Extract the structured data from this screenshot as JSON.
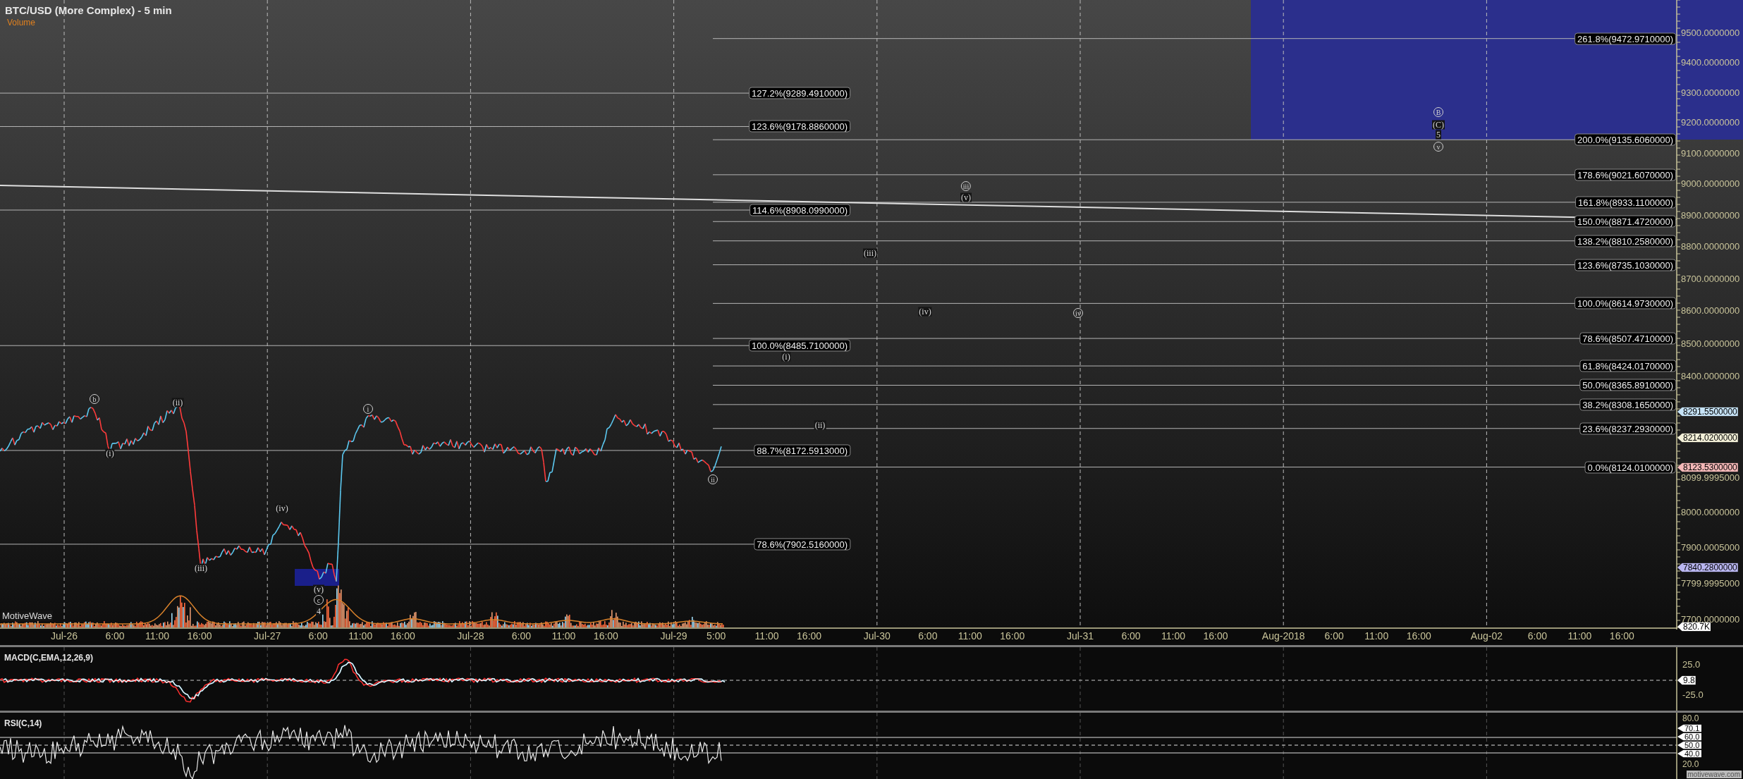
{
  "chart": {
    "title": "BTC/USD (More Complex) - 5 min",
    "overlay_label": "Volume",
    "brand_label": "MotiveWave"
  },
  "fib_levels_left": [
    "127.2%(9289.4910000)",
    "123.6%(9178.8860000)",
    "114.6%(8908.0990000)",
    "100.0%(8485.7100000)",
    "88.7%(8172.5913000)",
    "78.6%(7902.5160000)"
  ],
  "fib_levels_right": [
    "261.8%(9472.9710000)",
    "200.0%(9135.6060000)",
    "178.6%(9021.6070000)",
    "161.8%(8933.1100000)",
    "150.0%(8871.4720000)",
    "138.2%(8810.2580000)",
    "123.6%(8735.1030000)",
    "100.0%(8614.9730000)",
    "78.6%(8507.4710000)",
    "61.8%(8424.0170000)",
    "50.0%(8365.8910000)",
    "38.2%(8308.1650000)",
    "23.6%(8237.2930000)",
    "0.0%(8124.0100000)"
  ],
  "wave_labels": [
    {
      "text": "b",
      "kind": "circled"
    },
    {
      "text": "(ii)",
      "kind": "plain"
    },
    {
      "text": "(i)",
      "kind": "plain"
    },
    {
      "text": "(iii)",
      "kind": "plain"
    },
    {
      "text": "(iv)",
      "kind": "plain"
    },
    {
      "text": "(v)",
      "kind": "plain"
    },
    {
      "text": "c",
      "kind": "circled"
    },
    {
      "text": "4",
      "kind": "plain"
    },
    {
      "text": "i",
      "kind": "circled"
    },
    {
      "text": "ii",
      "kind": "circled"
    },
    {
      "text": "(i)",
      "kind": "plain"
    },
    {
      "text": "(ii)",
      "kind": "plain"
    },
    {
      "text": "(iii)",
      "kind": "plain"
    },
    {
      "text": "(iv)",
      "kind": "plain"
    },
    {
      "text": "iii",
      "kind": "circled"
    },
    {
      "text": "(v)",
      "kind": "plain"
    },
    {
      "text": "iv",
      "kind": "circled"
    },
    {
      "text": "B",
      "kind": "circled"
    },
    {
      "text": "(C)",
      "kind": "plain"
    },
    {
      "text": "5",
      "kind": "plain"
    },
    {
      "text": "v",
      "kind": "circled"
    }
  ],
  "price_axis": {
    "ticks": [
      "9500.0000000",
      "9400.0000000",
      "9300.0000000",
      "9200.0000000",
      "9100.0000000",
      "9000.0000000",
      "8900.0000000",
      "8800.0000000",
      "8700.0000000",
      "8600.0000000",
      "8500.0000000",
      "8400.0000000",
      "8099.9995000",
      "8000.0000000",
      "7900.0005000",
      "7799.9995000",
      "7700.0000000"
    ],
    "tags": [
      {
        "text": "8291.5500000",
        "color": "#c6e3f7"
      },
      {
        "text": "8214.0200000",
        "color": "#f3f0d8"
      },
      {
        "text": "8123.5300000",
        "color": "#f4b8b8"
      },
      {
        "text": "7840.2800000",
        "color": "#b9b6f0"
      },
      {
        "text": "820.7K",
        "color": "#ffffff"
      }
    ]
  },
  "time_axis": [
    "Jul-26",
    "6:00",
    "11:00",
    "16:00",
    "Jul-27",
    "6:00",
    "11:00",
    "16:00",
    "Jul-28",
    "6:00",
    "11:00",
    "16:00",
    "Jul-29",
    "5:00",
    "11:00",
    "16:00",
    "Jul-30",
    "6:00",
    "11:00",
    "16:00",
    "Jul-31",
    "6:00",
    "11:00",
    "16:00",
    "Aug-2018",
    "6:00",
    "11:00",
    "16:00",
    "Aug-02",
    "6:00",
    "11:00",
    "16:00"
  ],
  "macd": {
    "title": "MACD(C,EMA,12,26,9)",
    "ticks": [
      "25.0",
      "-25.0"
    ],
    "tags": [
      {
        "text": "9.8",
        "color": "#ffffff"
      }
    ]
  },
  "rsi": {
    "title": "RSI(C,14)",
    "ticks": [
      "80.0",
      "20.0"
    ],
    "tags": [
      {
        "text": "70.1",
        "color": "#ffffff"
      },
      {
        "text": "60.0",
        "color": "#ffffff"
      },
      {
        "text": "50.0",
        "color": "#ffffff"
      },
      {
        "text": "40.0",
        "color": "#ffffff"
      }
    ]
  },
  "footer": "motivewave.com"
}
